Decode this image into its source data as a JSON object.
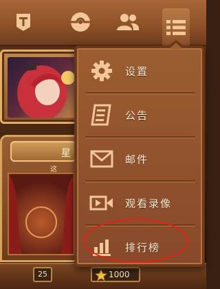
{
  "topbar": {
    "buttons": [
      {
        "name": "guild-banner",
        "icon": "banner-icon"
      },
      {
        "name": "pokeball",
        "icon": "ball-icon"
      },
      {
        "name": "friends",
        "icon": "friends-icon"
      },
      {
        "name": "menu",
        "icon": "list-menu-icon"
      }
    ]
  },
  "menu": {
    "items": [
      {
        "label": "设置",
        "icon": "gear-icon"
      },
      {
        "label": "公告",
        "icon": "notice-icon"
      },
      {
        "label": "邮件",
        "icon": "mail-icon"
      },
      {
        "label": "观看录像",
        "icon": "video-icon"
      },
      {
        "label": "排行榜",
        "icon": "ranking-icon"
      }
    ]
  },
  "hall": {
    "title": "星",
    "subtitle": "这"
  },
  "status": {
    "level": "25",
    "stars": "1000"
  },
  "colors": {
    "menu_bg": "#9c5d31",
    "icon_tan": "#f2c79a",
    "highlight": "#e32119",
    "label_text": "#fdeed4"
  }
}
